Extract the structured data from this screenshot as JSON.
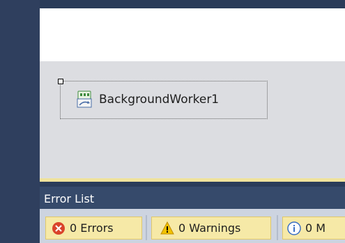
{
  "designer": {
    "component_label": "BackgroundWorker1",
    "component_icon": "background-worker-icon"
  },
  "error_list": {
    "title": "Error List",
    "filters": [
      {
        "label": "0 Errors",
        "icon": "error-icon",
        "color": "#d9432a"
      },
      {
        "label": "0 Warnings",
        "icon": "warning-icon",
        "color": "#f2c200"
      },
      {
        "label": "0 M",
        "icon": "info-icon",
        "color": "#3a6fc4"
      }
    ]
  }
}
